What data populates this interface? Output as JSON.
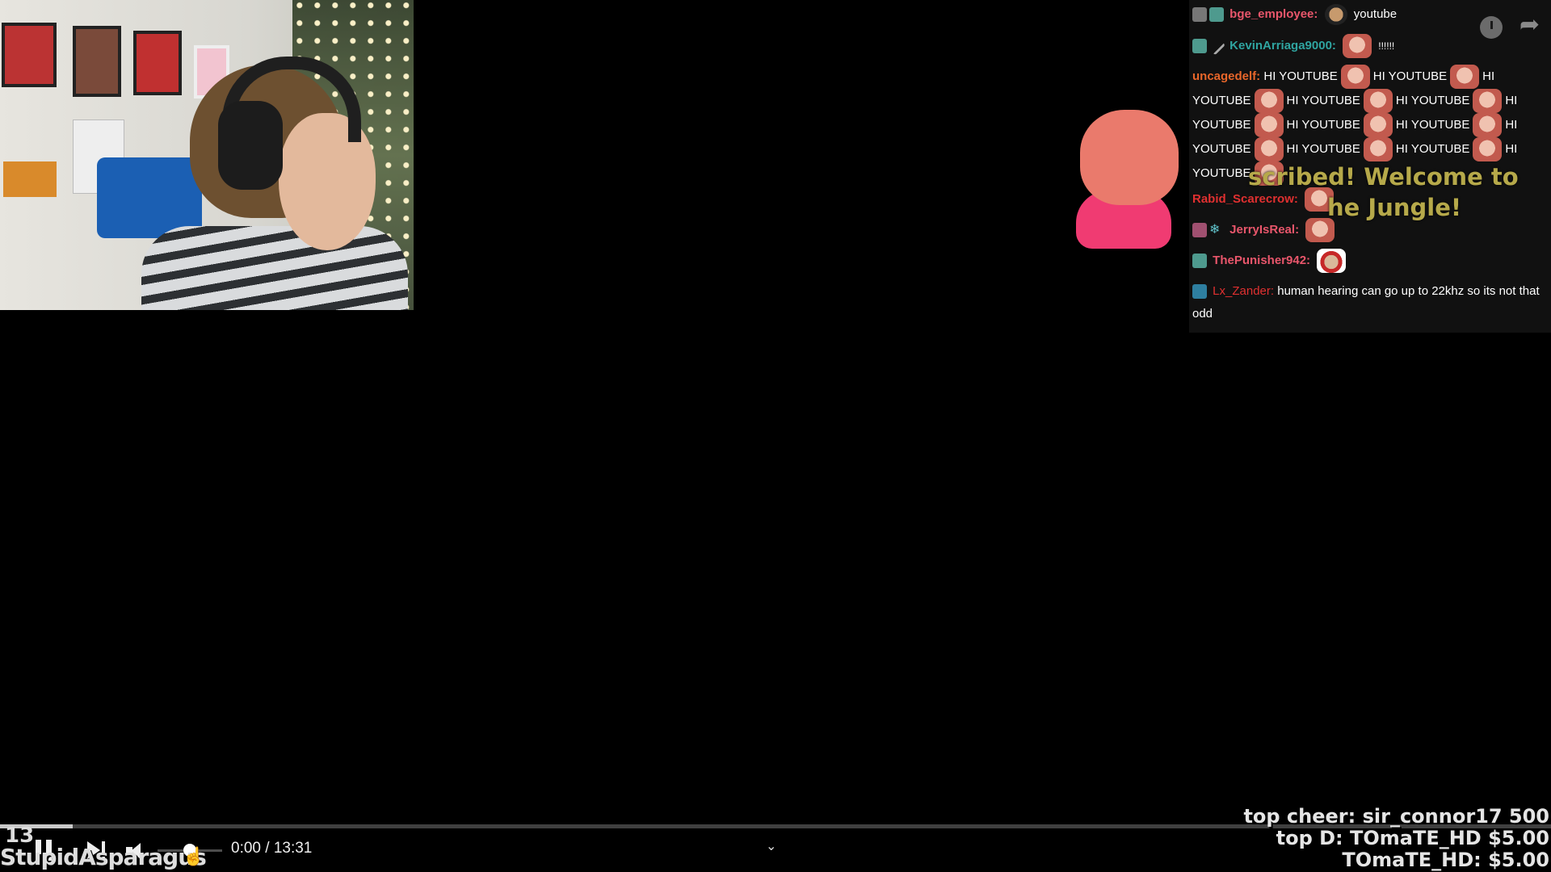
{
  "chat": {
    "messages": [
      {
        "username": "bge_employee:",
        "text": "youtube",
        "color": "#e8566b"
      },
      {
        "username": "KevinArriaga9000:",
        "text": "!!!!!!",
        "color": "#2fa4a0"
      },
      {
        "username": "uncagedelf:",
        "segments": [
          "HI YOUTUBE",
          "HI YOUTUBE",
          "HI",
          "YOUTUBE",
          "HI YOUTUBE",
          "HI YOUTUBE",
          "HI",
          "YOUTUBE",
          "HI YOUTUBE",
          "HI YOUTUBE",
          "HI",
          "YOUTUBE",
          "HI YOUTUBE",
          "HI YOUTUBE",
          "HI",
          "YOUTUBE"
        ],
        "color": "#e8662a"
      },
      {
        "username": "Rabid_Scarecrow:",
        "color": "#e03030"
      },
      {
        "username": "JerryIsReal:",
        "color": "#e8566b"
      },
      {
        "username": "ThePunisher942:",
        "color": "#e8566b"
      },
      {
        "username": "Lx_Zander:",
        "text": "human hearing can go up to 22khz so its not that odd",
        "color": "#e03030"
      }
    ]
  },
  "alert": {
    "line1": "scribed! Welcome to",
    "line2": "he Jungle!"
  },
  "player": {
    "time": "0:00 / 13:31",
    "progress_fraction": 0.047,
    "volume_fraction": 0.5
  },
  "overlay": {
    "number": "13",
    "name": "StupidAsparagus"
  },
  "donations": {
    "top_cheer": "top cheer: sir_connor17 500",
    "top_d": "top D: TOmaTE_HD $5.00",
    "latest": "TOmaTE_HD: $5.00"
  },
  "icons": [
    "clock-icon",
    "share-icon",
    "pause-icon",
    "next-icon",
    "volume-icon",
    "chevron-down-icon",
    "cursor-icon"
  ]
}
